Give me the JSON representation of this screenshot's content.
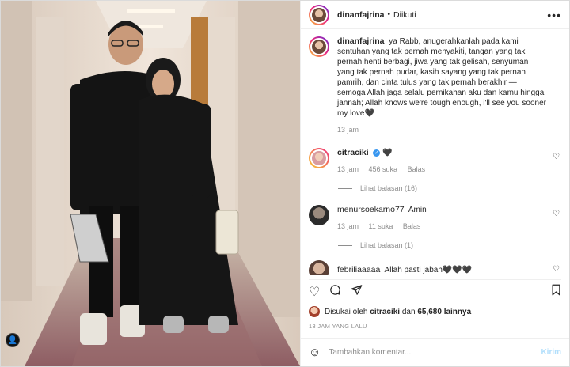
{
  "post": {
    "author": "dinanfajrina",
    "follow_status": "Diikuti",
    "more_icon": "more-icon"
  },
  "caption": {
    "author": "dinanfajrina",
    "text": "ya Rabb, anugerahkanlah pada kami sentuhan yang tak pernah menyakiti, tangan yang tak pernah henti berbagi, jiwa yang tak gelisah, senyuman yang tak pernah pudar, kasih sayang yang tak pernah pamrih, dan cinta tulus yang tak pernah berakhir — semoga Allah jaga selalu pernikahan aku dan kamu hingga jannah; Allah knows we're tough enough, i'll see you sooner my love🖤",
    "time": "13 jam"
  },
  "comments": [
    {
      "user": "citraciki",
      "verified": true,
      "text": "🖤",
      "time": "13 jam",
      "likes": "456 suka",
      "reply": "Balas",
      "view_replies": "Lihat balasan (16)"
    },
    {
      "user": "menursoekarno77",
      "text": "Amin",
      "time": "13 jam",
      "likes": "11 suka",
      "reply": "Balas",
      "view_replies": "Lihat balasan (1)"
    },
    {
      "user": "febriliaaaaa",
      "text": "Allah pasti jabah🖤🖤🖤"
    }
  ],
  "liked_by": {
    "prefix": "Disukai oleh",
    "user": "citraciki",
    "mid": "dan",
    "count": "65,680 lainnya"
  },
  "posted_ago": "13 JAM YANG LALU",
  "comment_box": {
    "placeholder": "Tambahkan komentar...",
    "send_label": "Kirim"
  },
  "icons": {
    "like": "heart-icon",
    "comment": "comment-icon",
    "share": "send-icon",
    "save": "bookmark-icon",
    "emoji": "emoji-icon"
  }
}
